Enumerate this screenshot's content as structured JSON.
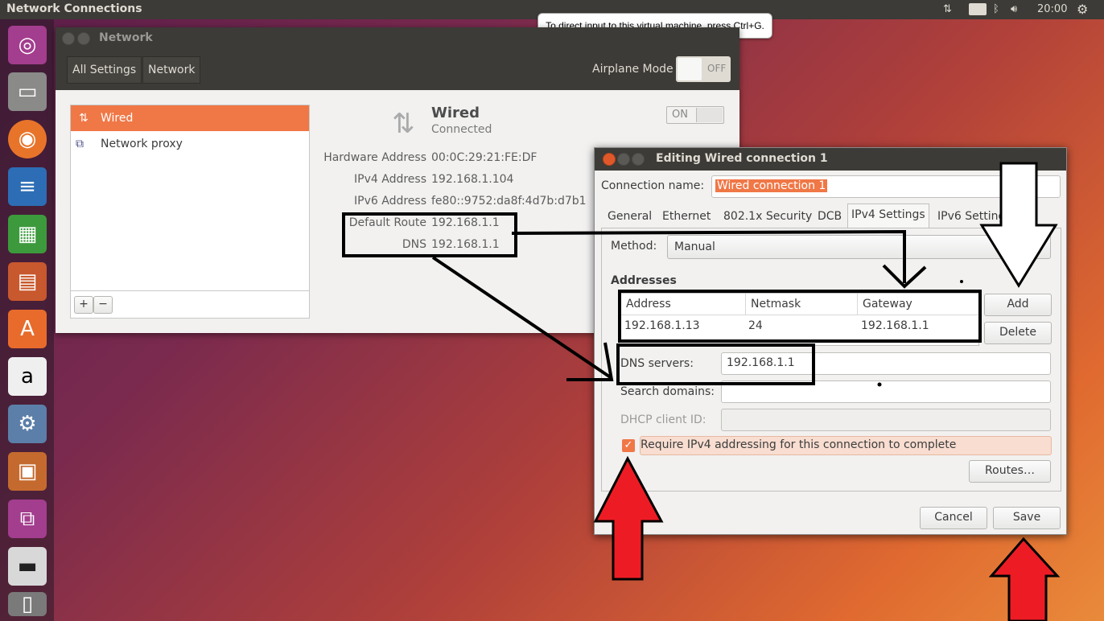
{
  "top_panel": {
    "title": "Network Connections",
    "keyboard": "En",
    "time": "20:00"
  },
  "tooltip": "To direct input to this virtual machine, press Ctrl+G.",
  "network_window": {
    "title": "Network",
    "breadcrumb": [
      "All Settings",
      "Network"
    ],
    "airplane_label": "Airplane Mode",
    "airplane_state": "OFF",
    "list": [
      "Wired",
      "Network proxy"
    ],
    "add_btn": "+",
    "remove_btn": "−",
    "device_title": "Wired",
    "device_status": "Connected",
    "device_toggle": "ON",
    "details": [
      {
        "label": "Hardware Address",
        "value": "00:0C:29:21:FE:DF"
      },
      {
        "label": "IPv4 Address",
        "value": "192.168.1.104"
      },
      {
        "label": "IPv6 Address",
        "value": "fe80::9752:da8f:4d7b:d7b1"
      },
      {
        "label": "Default Route",
        "value": "192.168.1.1"
      },
      {
        "label": "DNS",
        "value": "192.168.1.1"
      }
    ]
  },
  "dialog": {
    "title": "Editing Wired connection 1",
    "conn_name_label": "Connection name:",
    "conn_name_value": "Wired connection 1",
    "tabs": [
      "General",
      "Ethernet",
      "802.1x Security",
      "DCB",
      "IPv4 Settings",
      "IPv6 Setting"
    ],
    "method_label": "Method:",
    "method_value": "Manual",
    "addresses_label": "Addresses",
    "columns": [
      "Address",
      "Netmask",
      "Gateway"
    ],
    "rows": [
      [
        "192.168.1.13",
        "24",
        "192.168.1.1"
      ]
    ],
    "add_label": "Add",
    "delete_label": "Delete",
    "dns_label": "DNS servers:",
    "dns_value": "192.168.1.1",
    "search_label": "Search domains:",
    "dhcp_label": "DHCP client ID:",
    "require_label": "Require IPv4 addressing for this connection to complete",
    "routes_label": "Routes…",
    "cancel_label": "Cancel",
    "save_label": "Save"
  },
  "colors": {
    "accent": "#f07746",
    "panel": "#3c3b37",
    "arrow_red": "#ed1c24"
  }
}
